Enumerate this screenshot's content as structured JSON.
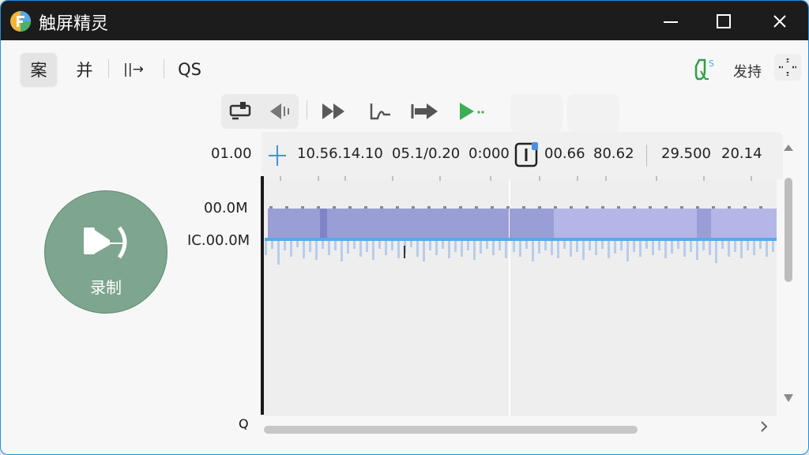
{
  "window": {
    "title": "触屏精灵"
  },
  "toolbar": {
    "tab1": "案",
    "tab2": "并",
    "tab3": "||→",
    "tab4": "QS",
    "right_label": "发持"
  },
  "left_numbers": {
    "top": "01.00",
    "mid": "00.0M",
    "bottom": "IC.00.0M"
  },
  "ruler": {
    "t1": "10.56.14.10",
    "t2": "05.1/0.20",
    "t3": "0:000",
    "t4": "00.66",
    "t5": "80.62",
    "t6": "29.500",
    "t7": "20.14"
  },
  "record": {
    "label": "录制"
  },
  "zoom_label": "Q",
  "colors": {
    "titlebar": "#1c1c1c",
    "accent_blue": "#1f8fd8",
    "record_green": "#7ea58e",
    "track_purple": "#9a9ed6"
  }
}
